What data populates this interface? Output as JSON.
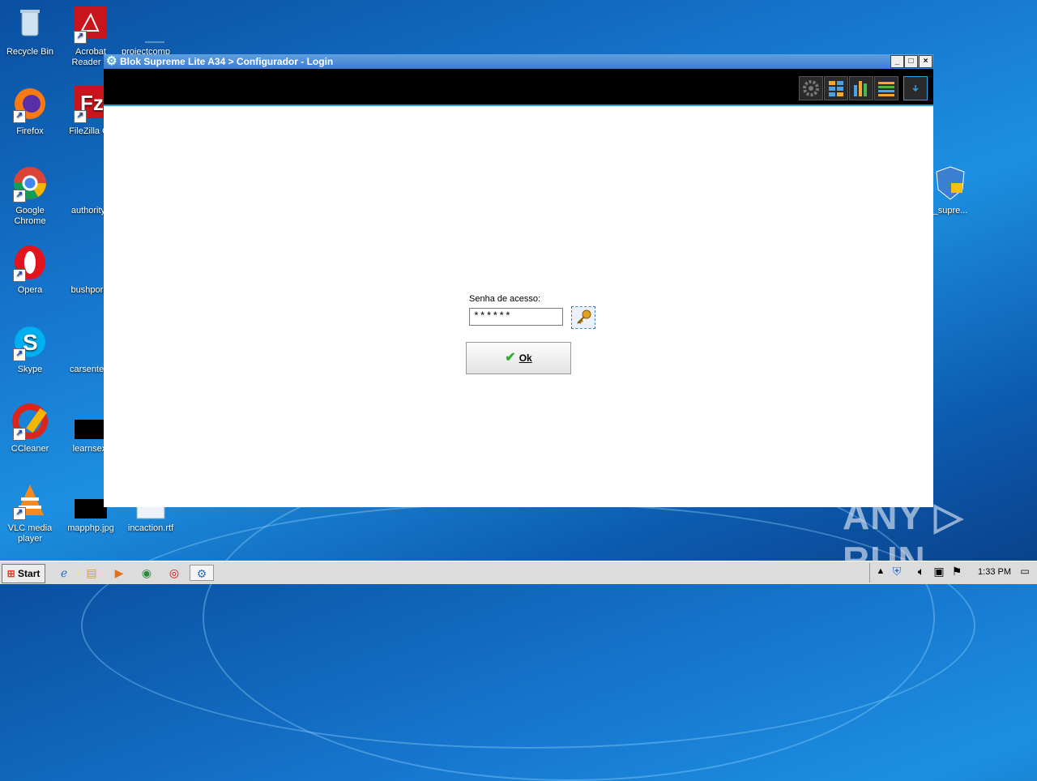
{
  "desktop": {
    "icons": [
      {
        "label": "Recycle Bin"
      },
      {
        "label": "Acrobat Reader D"
      },
      {
        "label": "projectcomp"
      },
      {
        "label": "Firefox"
      },
      {
        "label": "FileZilla Cli"
      },
      {
        "label": "Google Chrome"
      },
      {
        "label": "authorityn"
      },
      {
        "label": "Opera"
      },
      {
        "label": "bushporn."
      },
      {
        "label": "Skype"
      },
      {
        "label": "carsenterp"
      },
      {
        "label": "CCleaner"
      },
      {
        "label": "learnsex."
      },
      {
        "label": "VLC media player"
      },
      {
        "label": "mapphp.jpg"
      },
      {
        "label": "incaction.rtf"
      },
      {
        "label": "_supre..."
      }
    ]
  },
  "window": {
    "title": "Blok Supreme Lite A34 > Configurador - Login",
    "controls": {
      "minimize": "_",
      "maximize": "□",
      "close": "×"
    }
  },
  "login": {
    "password_label": "Senha de acesso:",
    "password_value": "******",
    "ok_label": "Ok"
  },
  "taskbar": {
    "start_label": "Start",
    "clock": "1:33 PM"
  },
  "watermark": "ANY ▷ RUN"
}
